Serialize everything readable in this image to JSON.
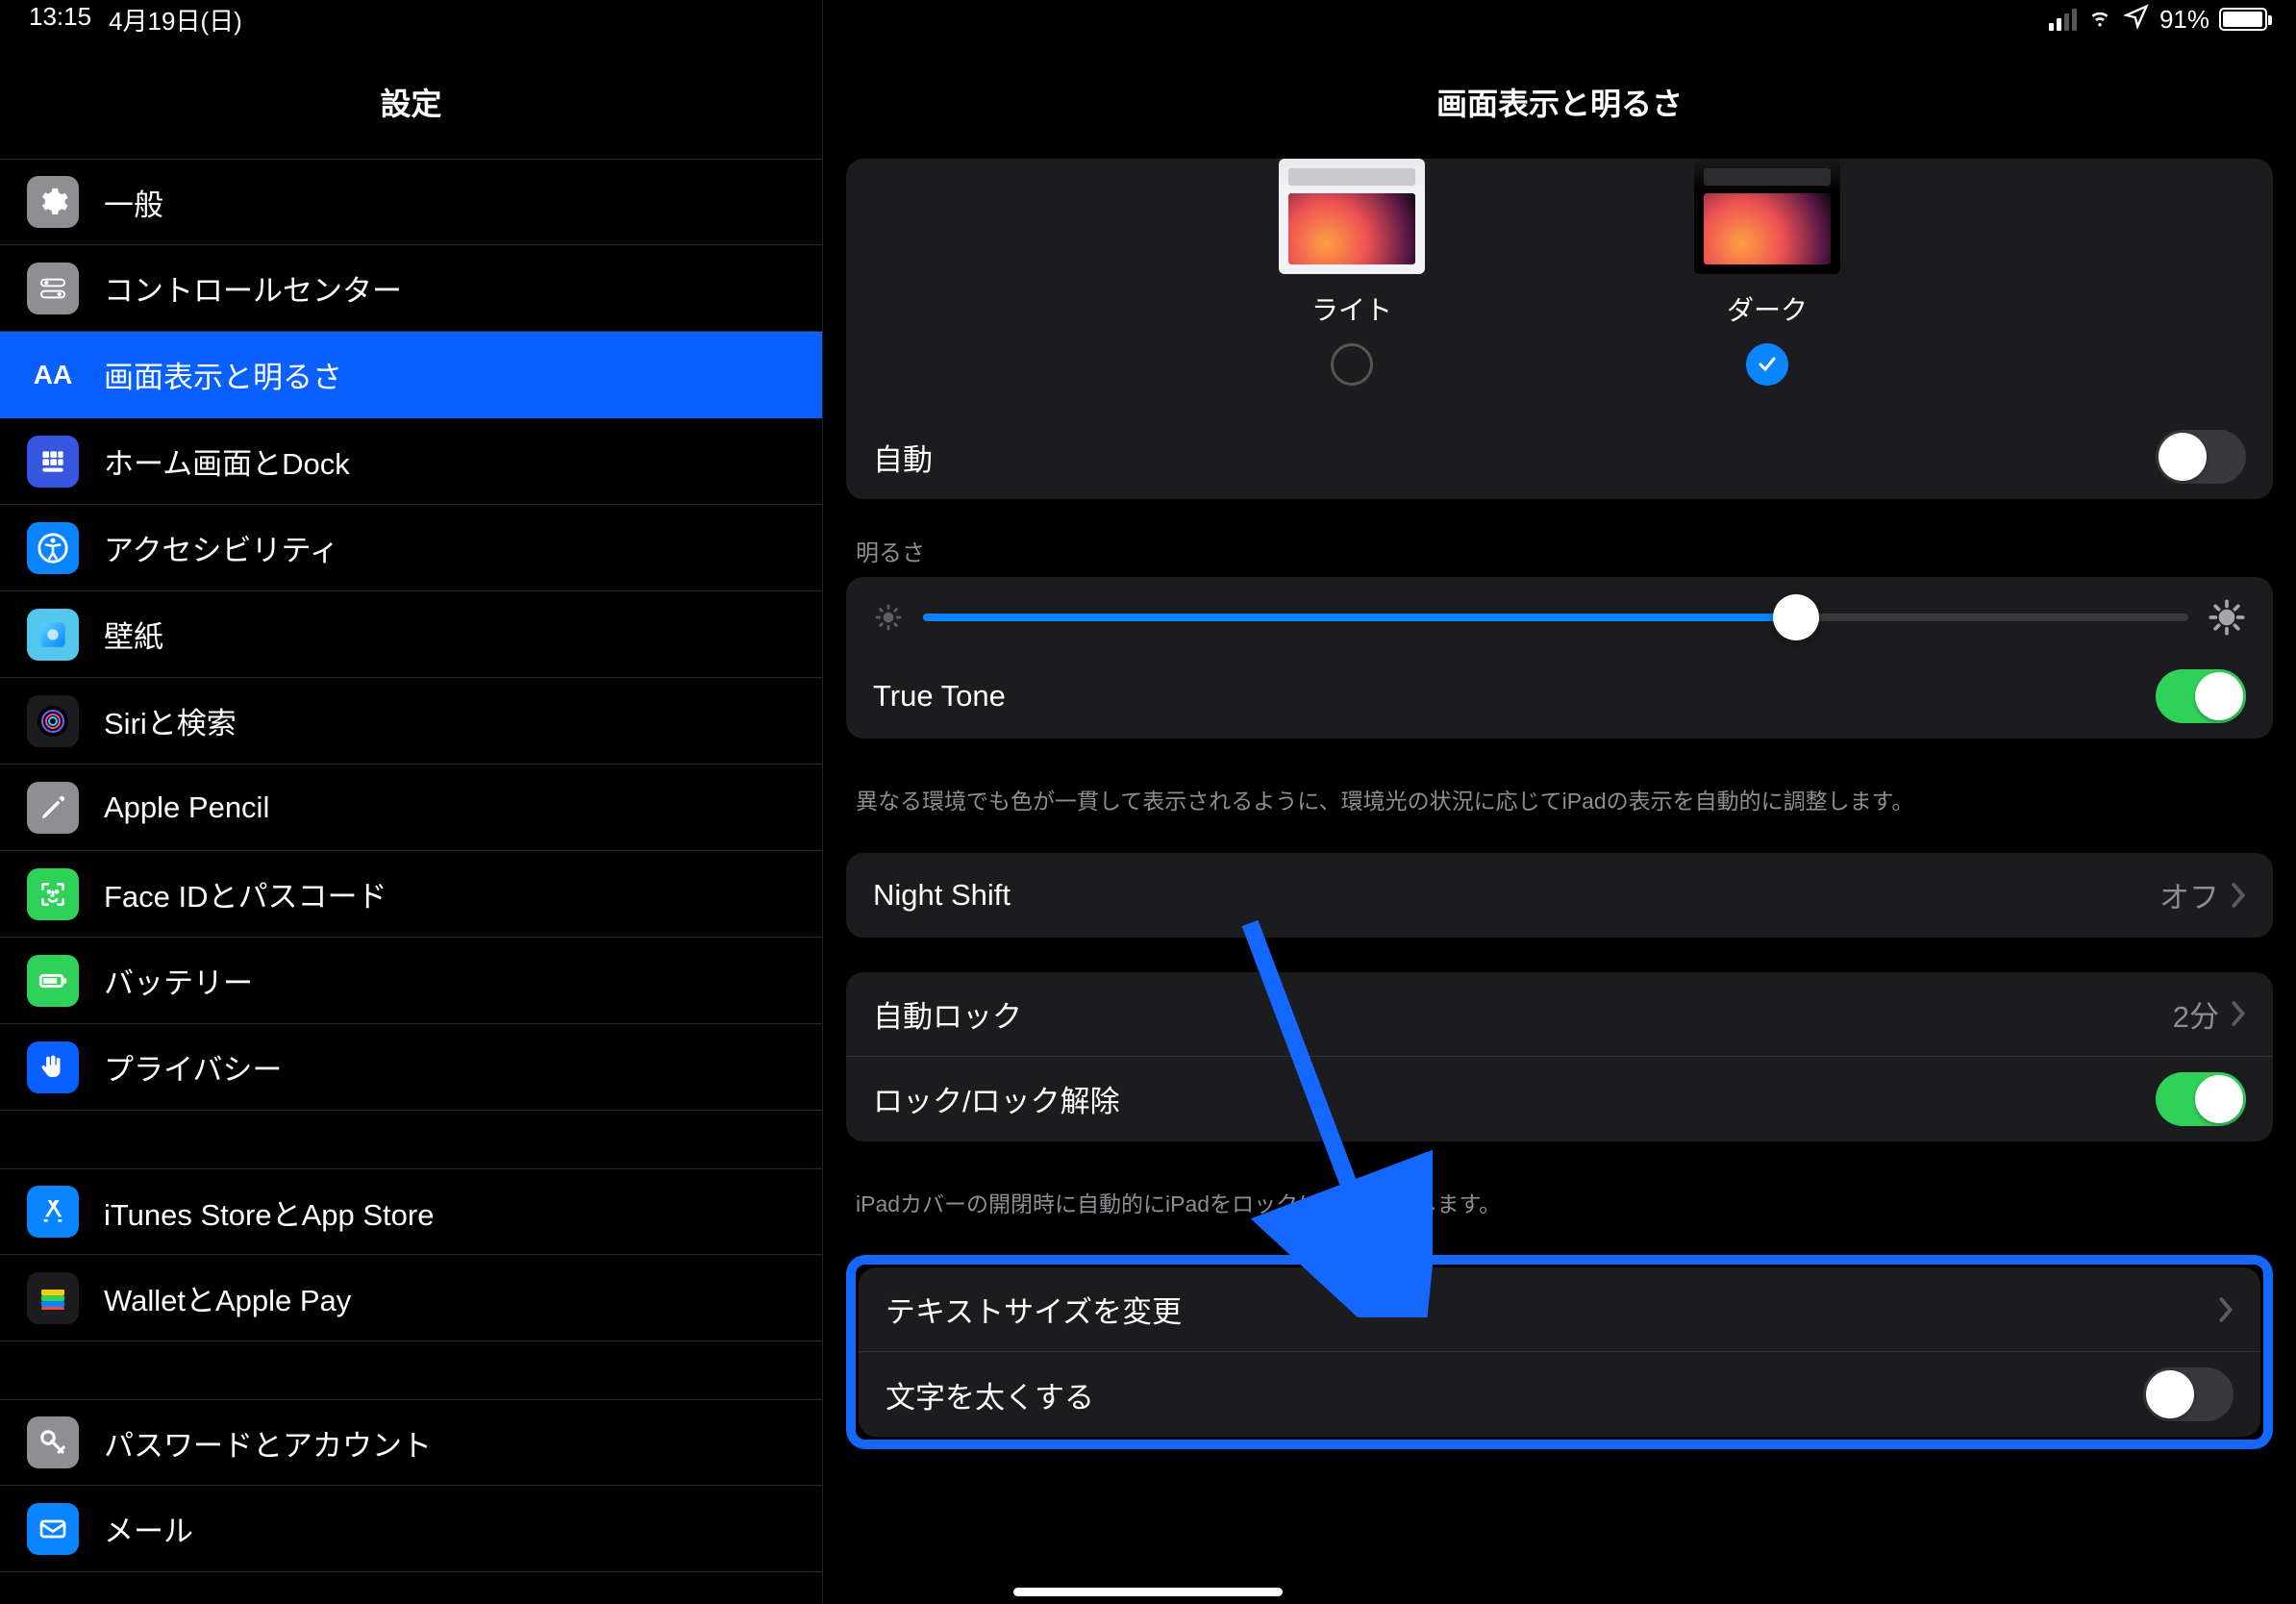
{
  "status": {
    "time": "13:15",
    "date": "4月19日(日)",
    "battery": "91%"
  },
  "sidebar": {
    "title": "設定",
    "section1": [
      {
        "label": "一般",
        "icon": "gear"
      },
      {
        "label": "コントロールセンター",
        "icon": "toggles"
      },
      {
        "label": "画面表示と明るさ",
        "icon": "aa"
      },
      {
        "label": "ホーム画面とDock",
        "icon": "grid"
      },
      {
        "label": "アクセシビリティ",
        "icon": "accessibility"
      },
      {
        "label": "壁紙",
        "icon": "wallpaper"
      },
      {
        "label": "Siriと検索",
        "icon": "siri"
      },
      {
        "label": "Apple Pencil",
        "icon": "pencil"
      },
      {
        "label": "Face IDとパスコード",
        "icon": "faceid"
      },
      {
        "label": "バッテリー",
        "icon": "battery"
      },
      {
        "label": "プライバシー",
        "icon": "privacy"
      }
    ],
    "section2": [
      {
        "label": "iTunes StoreとApp Store",
        "icon": "appstore"
      },
      {
        "label": "WalletとApple Pay",
        "icon": "wallet"
      }
    ],
    "section3": [
      {
        "label": "パスワードとアカウント",
        "icon": "key"
      },
      {
        "label": "メール",
        "icon": "mail"
      }
    ]
  },
  "main": {
    "title": "画面表示と明るさ",
    "appearance": {
      "light_label": "ライト",
      "dark_label": "ダーク"
    },
    "auto_label": "自動",
    "brightness_header": "明るさ",
    "true_tone_label": "True Tone",
    "true_tone_footer": "異なる環境でも色が一貫して表示されるように、環境光の状況に応じてiPadの表示を自動的に調整します。",
    "night_shift_label": "Night Shift",
    "night_shift_value": "オフ",
    "auto_lock_label": "自動ロック",
    "auto_lock_value": "2分",
    "lock_unlock_label": "ロック/ロック解除",
    "lock_unlock_footer": "iPadカバーの開閉時に自動的にiPadをロック/ロック解除します。",
    "text_size_label": "テキストサイズを変更",
    "bold_text_label": "文字を太くする"
  }
}
